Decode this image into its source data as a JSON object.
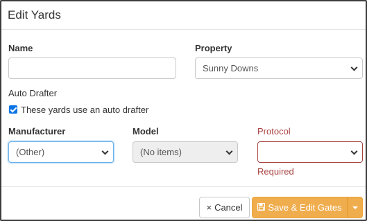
{
  "dialog": {
    "title": "Edit Yards"
  },
  "form": {
    "name": {
      "label": "Name",
      "value": ""
    },
    "property": {
      "label": "Property",
      "selected": "Sunny Downs"
    },
    "auto_drafter": {
      "heading": "Auto Drafter",
      "checkbox_label": "These yards use an auto drafter",
      "checked": true
    },
    "manufacturer": {
      "label": "Manufacturer",
      "selected": "(Other)"
    },
    "model": {
      "label": "Model",
      "selected": "(No items)"
    },
    "protocol": {
      "label": "Protocol",
      "selected": "",
      "error": "Required"
    }
  },
  "footer": {
    "cancel_label": "Cancel",
    "cancel_icon": "×",
    "save_label": "Save & Edit Gates",
    "save_icon": "floppy-disk-icon"
  },
  "colors": {
    "accent": "#f0ad4e",
    "error": "#a94442",
    "checkbox": "#0b74e5",
    "focus": "#66afe9"
  }
}
